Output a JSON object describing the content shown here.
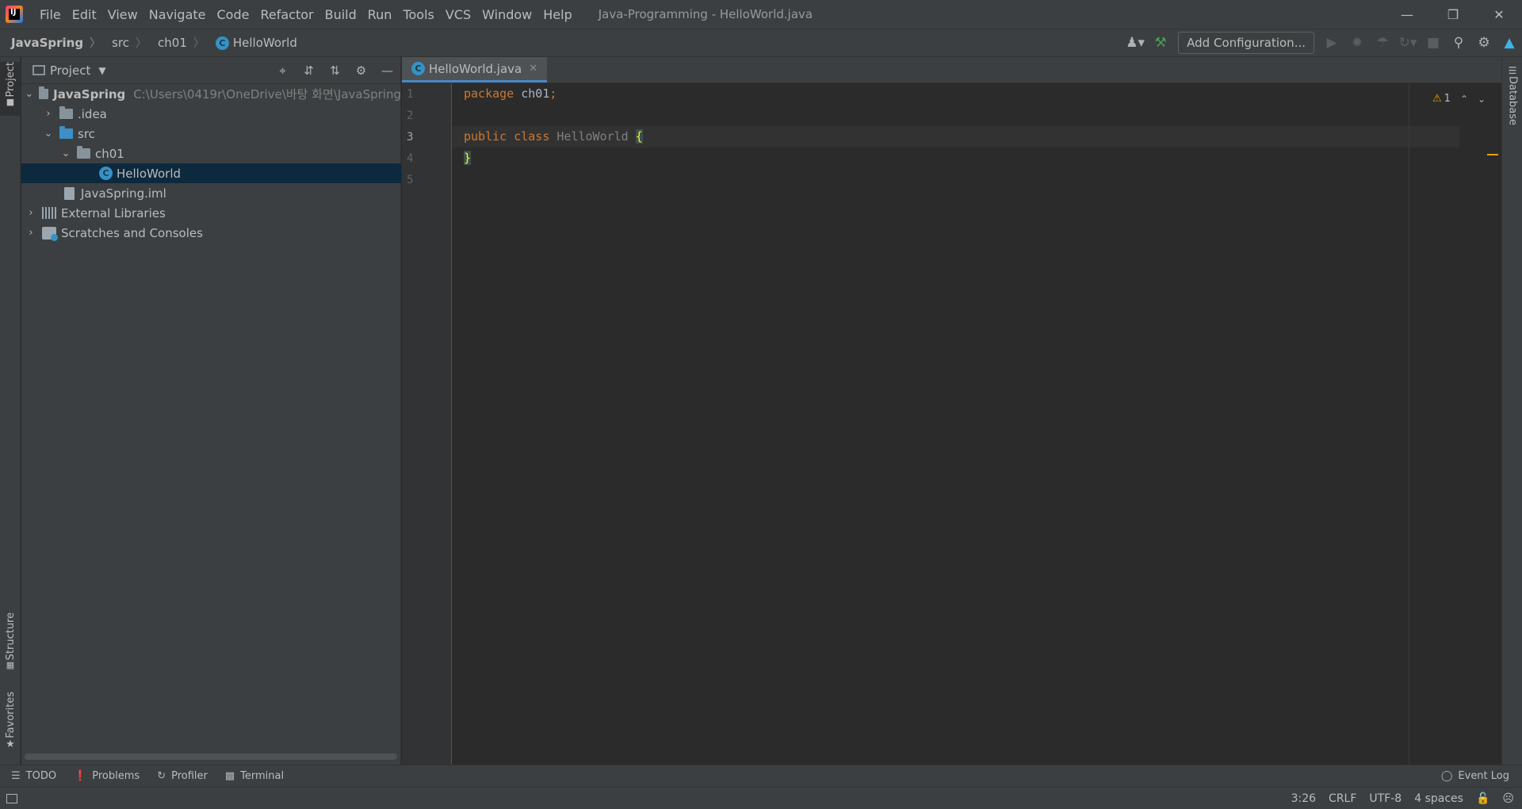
{
  "menu": {
    "items": [
      "File",
      "Edit",
      "View",
      "Navigate",
      "Code",
      "Refactor",
      "Build",
      "Run",
      "Tools",
      "VCS",
      "Window",
      "Help"
    ],
    "window_title": "Java-Programming - HelloWorld.java"
  },
  "breadcrumb": [
    "JavaSpring",
    "src",
    "ch01",
    "HelloWorld"
  ],
  "toolbar": {
    "add_configuration": "Add Configuration..."
  },
  "side_tabs": {
    "project": "Project",
    "structure": "Structure",
    "favorites": "Favorites",
    "database": "Database"
  },
  "project_panel": {
    "title": "Project",
    "tree": [
      {
        "label": "JavaSpring",
        "hint": "C:\\Users\\0419r\\OneDrive\\바탕 화면\\JavaSpring",
        "depth": 0,
        "expanded": true,
        "icon": "module-folder-icon"
      },
      {
        "label": ".idea",
        "depth": 1,
        "expanded": false,
        "icon": "folder-icon"
      },
      {
        "label": "src",
        "depth": 1,
        "expanded": true,
        "icon": "source-folder-icon"
      },
      {
        "label": "ch01",
        "depth": 2,
        "expanded": true,
        "icon": "package-icon"
      },
      {
        "label": "HelloWorld",
        "depth": 3,
        "selected": true,
        "icon": "class-icon"
      },
      {
        "label": "JavaSpring.iml",
        "depth": 1,
        "icon": "iml-file-icon"
      },
      {
        "label": "External Libraries",
        "depth": 0,
        "expanded": false,
        "icon": "library-icon"
      },
      {
        "label": "Scratches and Consoles",
        "depth": 0,
        "expanded": false,
        "icon": "scratches-icon"
      }
    ]
  },
  "editor": {
    "tab_label": "HelloWorld.java",
    "line_numbers": [
      "1",
      "2",
      "3",
      "4",
      "5"
    ],
    "current_line": "3",
    "code": {
      "line1_kw": "package",
      "line1_rest": " ch01",
      "line1_semi": ";",
      "line3_kw": "public class",
      "line3_name": "HelloWorld",
      "line3_brace": "{",
      "line4_brace": "}"
    },
    "inspection_count": "1"
  },
  "bottom_tools": [
    "TODO",
    "Problems",
    "Profiler",
    "Terminal"
  ],
  "event_log": "Event Log",
  "status": {
    "position": "3:26",
    "line_separator": "CRLF",
    "encoding": "UTF-8",
    "indent": "4 spaces"
  },
  "colors": {
    "keyword": "#cc7832",
    "selection": "#0d293e",
    "accent": "#4a88c7",
    "warning": "#e5a400"
  }
}
